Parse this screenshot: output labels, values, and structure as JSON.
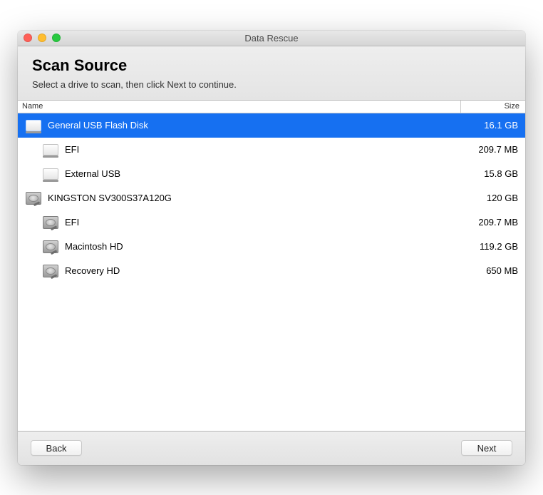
{
  "window": {
    "title": "Data Rescue"
  },
  "header": {
    "title": "Scan Source",
    "subtitle": "Select a drive to scan, then click Next to continue."
  },
  "columns": {
    "name": "Name",
    "size": "Size"
  },
  "drives": [
    {
      "name": "General USB Flash Disk",
      "size": "16.1 GB",
      "depth": 0,
      "icon": "external",
      "selected": true
    },
    {
      "name": "EFI",
      "size": "209.7 MB",
      "depth": 1,
      "icon": "external",
      "selected": false
    },
    {
      "name": "External USB",
      "size": "15.8 GB",
      "depth": 1,
      "icon": "external",
      "selected": false
    },
    {
      "name": "KINGSTON SV300S37A120G",
      "size": "120 GB",
      "depth": 0,
      "icon": "internal",
      "selected": false
    },
    {
      "name": "EFI",
      "size": "209.7 MB",
      "depth": 1,
      "icon": "internal",
      "selected": false
    },
    {
      "name": "Macintosh HD",
      "size": "119.2 GB",
      "depth": 1,
      "icon": "internal",
      "selected": false
    },
    {
      "name": "Recovery HD",
      "size": "650 MB",
      "depth": 1,
      "icon": "internal",
      "selected": false
    }
  ],
  "buttons": {
    "back": "Back",
    "next": "Next"
  }
}
